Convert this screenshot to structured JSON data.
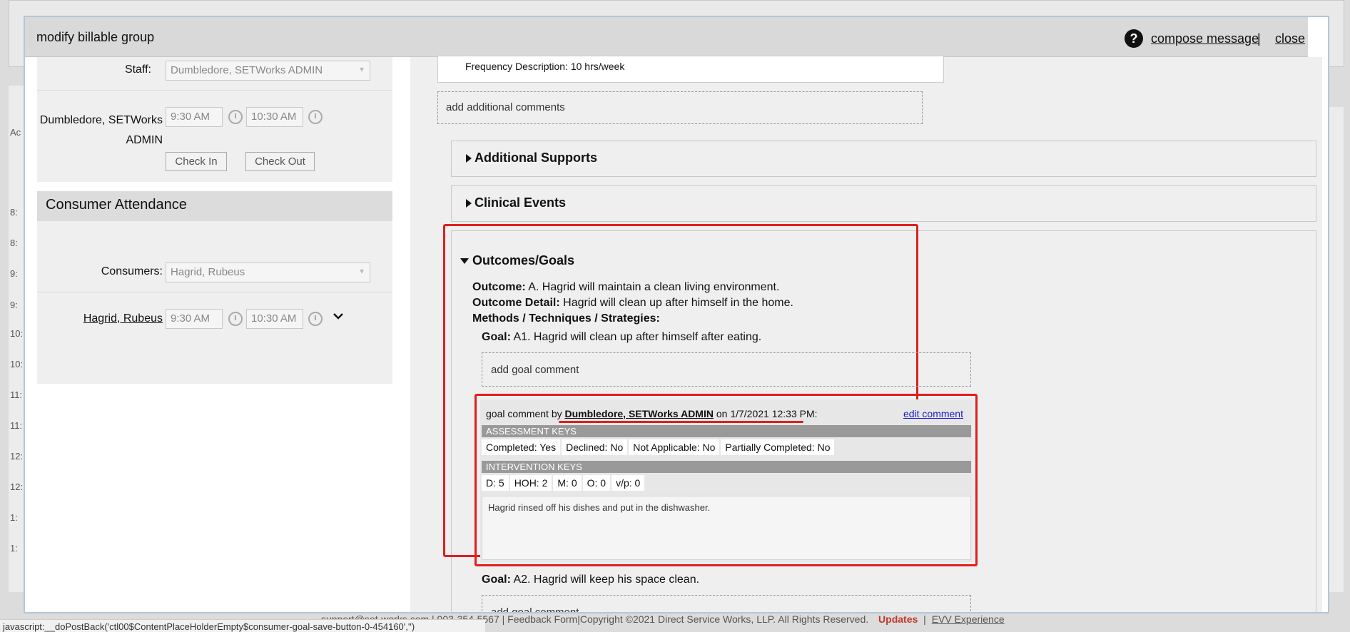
{
  "dialog": {
    "title": "modify billable group",
    "help_label": "?",
    "compose_message": "compose message",
    "separator": "|",
    "close": "close"
  },
  "staff": {
    "label": "Staff:",
    "value": "Dumbledore, SETWorks ADMIN",
    "name_line1": "Dumbledore, SETWorks",
    "name_line2": "ADMIN",
    "time_in": "9:30 AM",
    "time_out": "10:30 AM",
    "check_in": "Check In",
    "check_out": "Check Out"
  },
  "consumer_attendance": {
    "heading": "Consumer Attendance",
    "label": "Consumers:",
    "value": "Hagrid, Rubeus",
    "consumer_name": "Hagrid, Rubeus",
    "time_in": "9:30 AM",
    "time_out": "10:30 AM"
  },
  "right": {
    "frequency": "Frequency Description: 10 hrs/week",
    "additional_comments": "add additional comments",
    "sections": {
      "additional_supports": "Additional Supports",
      "clinical_events": "Clinical Events",
      "outcomes_goals": "Outcomes/Goals"
    },
    "outcome_label": "Outcome:",
    "outcome_value": "A. Hagrid will maintain a clean living environment.",
    "detail_label": "Outcome Detail:",
    "detail_value": "Hagrid will clean up after himself in the home.",
    "methods_label": "Methods / Techniques / Strategies:",
    "goal1_label": "Goal:",
    "goal1_value": "A1. Hagrid will clean up after himself after eating.",
    "add_goal_comment_1": "add goal comment",
    "comment": {
      "prefix": "goal comment by",
      "author": "Dumbledore, SETWorks ADMIN",
      "on_text": "on 1/7/2021 12:33 PM:",
      "edit": "edit comment",
      "assessment_header": "ASSESSMENT KEYS",
      "assessment_keys": [
        "Completed: Yes",
        "Declined: No",
        "Not Applicable: No",
        "Partially Completed: No"
      ],
      "intervention_header": "INTERVENTION KEYS",
      "intervention_keys": [
        "D: 5",
        "HOH: 2",
        "M: 0",
        "O: 0",
        "v/p: 0"
      ],
      "body": "Hagrid rinsed off his dishes and put in the dishwasher."
    },
    "goal2_label": "Goal:",
    "goal2_value": "A2. Hagrid will keep his space clean.",
    "add_goal_comment_2": "add goal comment"
  },
  "footer": {
    "text": "support@set-works.com | 903-354-5567 | Feedback Form|Copyright ©2021 Direct Service Works, LLP. All Rights Reserved.",
    "updates": "Updates",
    "evv": "EVV Experience"
  },
  "status_bar": "javascript:__doPostBack('ctl00$ContentPlaceHolderEmpty$consumer-goal-save-button-0-454160','')",
  "background_numbers": [
    "8:",
    "8:",
    "9:",
    "9:",
    "10:",
    "10:",
    "11:",
    "11:",
    "12:",
    "12:",
    "1:",
    "1:"
  ],
  "background_label": "Ac"
}
